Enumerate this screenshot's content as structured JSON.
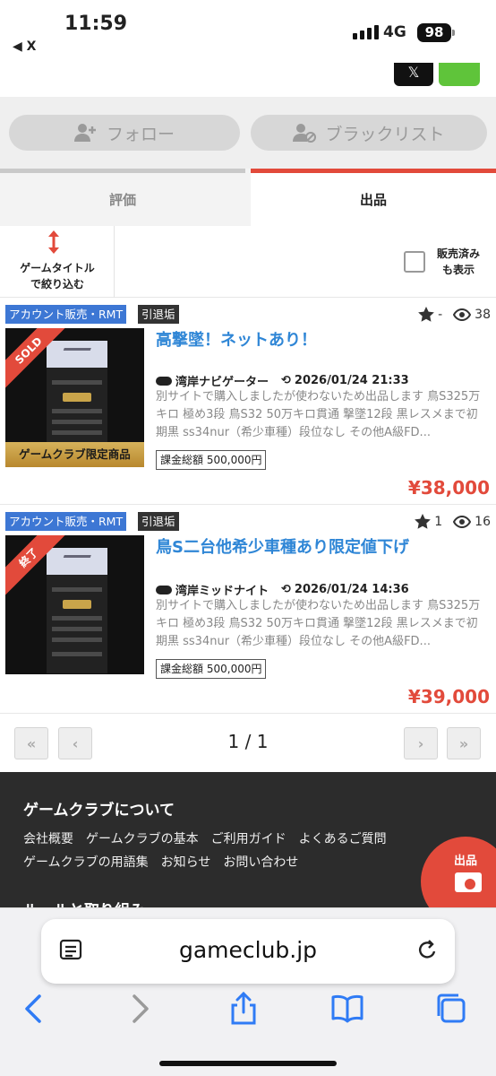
{
  "status_bar": {
    "time": "11:59",
    "back_label": "◀ X",
    "network": "4G",
    "battery": "98"
  },
  "share": {
    "x_label": "𝕏"
  },
  "actions": {
    "follow": "フォロー",
    "blacklist": "ブラックリスト"
  },
  "tabs": [
    {
      "label": "評価",
      "active": false
    },
    {
      "label": "出品",
      "active": true
    }
  ],
  "filter": {
    "title_filter": "ゲームタイトル\nで絞り込む",
    "sold_toggle": "販売済み\nも表示"
  },
  "listings": [
    {
      "category_tag": "アカウント販売・RMT",
      "status_tag": "引退垢",
      "rating": "-",
      "views": "38",
      "ribbon": "SOLD",
      "badge": "ゲームクラブ限定商品",
      "title": "高撃墜！ネットあり！",
      "game": "湾岸ナビゲーター",
      "date": "2026/01/24 21:33",
      "description": "別サイトで購入しましたが使わないため出品します 鳥S325万キロ 極め3段 鳥S32 50万キロ貫通 撃墜12段 黒レスメまで初期黒 ss34nur（希少車種）段位なし その他A級FD...",
      "total_label": "課金総額",
      "total_value": "500,000円",
      "price": "¥38,000"
    },
    {
      "category_tag": "アカウント販売・RMT",
      "status_tag": "引退垢",
      "rating": "1",
      "views": "16",
      "ribbon": "終了",
      "badge": "",
      "title": "鳥S二台他希少車種あり限定値下げ",
      "game": "湾岸ミッドナイト",
      "date": "2026/01/24 14:36",
      "description": "別サイトで購入しましたが使わないため出品します 鳥S325万キロ 極め3段 鳥S32 50万キロ貫通 撃墜12段 黒レスメまで初期黒 ss34nur（希少車種）段位なし その他A級FD...",
      "total_label": "課金総額",
      "total_value": "500,000円",
      "price": "¥39,000"
    }
  ],
  "pagination": {
    "first": "«",
    "prev": "‹",
    "info": "1 / 1",
    "next": "›",
    "last": "»"
  },
  "footer": {
    "about_title": "ゲームクラブについて",
    "links_row1": [
      "会社概要",
      "ゲームクラブの基本",
      "ご利用ガイド",
      "よくあるご質問"
    ],
    "links_row2": [
      "ゲームクラブの用語集",
      "お知らせ",
      "お問い合わせ"
    ],
    "rules_title": "ルールと取り組み"
  },
  "sell_button": {
    "label": "出品"
  },
  "browser": {
    "url": "gameclub.jp"
  },
  "colors": {
    "accent": "#e24a3b",
    "link": "#2f86d6",
    "tag_blue": "#3d77d4"
  }
}
